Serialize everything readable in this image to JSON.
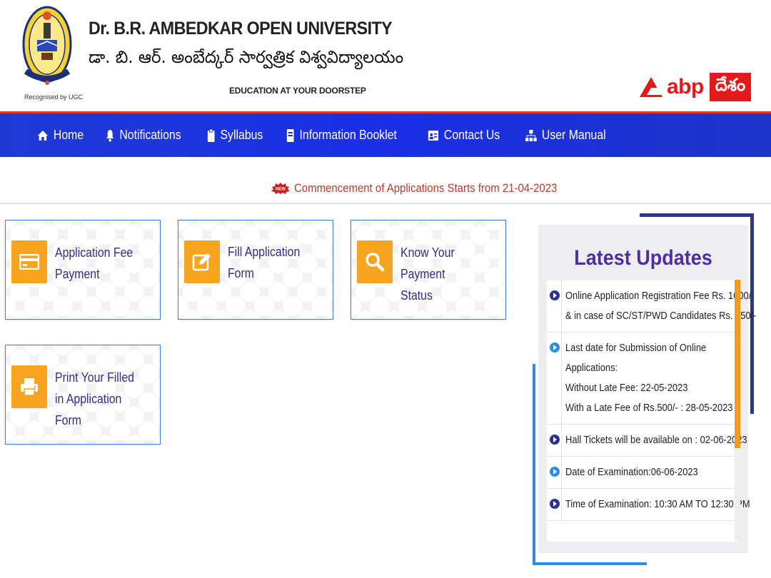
{
  "header": {
    "university_en": "Dr. B.R. AMBEDKAR OPEN UNIVERSITY",
    "university_te": "డా. బి. ఆర్. అంబేద్కర్ సార్వత్రిక విశ్వవిద్యాలయం",
    "tagline": "EDUCATION AT YOUR DOORSTEP",
    "logo_caption": "Recognised by UGC",
    "brand": {
      "abp": "abp",
      "desam": "దేశం",
      "color": "#e3191b"
    }
  },
  "nav": {
    "items": [
      {
        "label": "Home",
        "icon": "home-icon"
      },
      {
        "label": "Notifications",
        "icon": "bell-icon"
      },
      {
        "label": "Syllabus",
        "icon": "clipboard-icon"
      },
      {
        "label": "Information Booklet",
        "icon": "book-icon"
      },
      {
        "label": "Contact Us",
        "icon": "contact-card-icon"
      },
      {
        "label": "User Manual",
        "icon": "sitemap-icon"
      }
    ],
    "color": "#1a2fe6"
  },
  "announcement": {
    "badge": "NEW",
    "text": "Commencement of Applications Starts from 21-04-2023"
  },
  "cards": [
    {
      "label": "Application Fee Payment",
      "icon": "credit-card-icon"
    },
    {
      "label": "Fill Application Form",
      "icon": "edit-icon"
    },
    {
      "label": "Know Your Payment Status",
      "icon": "search-icon"
    },
    {
      "label": "Print Your Filled in Application Form",
      "icon": "printer-icon"
    }
  ],
  "updates": {
    "title": "Latest Updates",
    "items": [
      {
        "lines": [
          "Online Application Registration Fee Rs. 1000/-",
          "& in case of SC/ST/PWD Candidates Rs. 750/-"
        ]
      },
      {
        "lines": [
          "Last date for Submission of Online",
          "Applications:",
          "Without Late Fee: 22-05-2023",
          "With a Late Fee of Rs.500/- : 28-05-2023"
        ]
      },
      {
        "lines": [
          "Hall Tickets will be available on : 02-06-2023"
        ]
      },
      {
        "lines": [
          "Date of Examination:06-06-2023"
        ]
      },
      {
        "lines": [
          "Time of Examination: 10:30 AM TO 12:30 PM"
        ]
      }
    ]
  }
}
